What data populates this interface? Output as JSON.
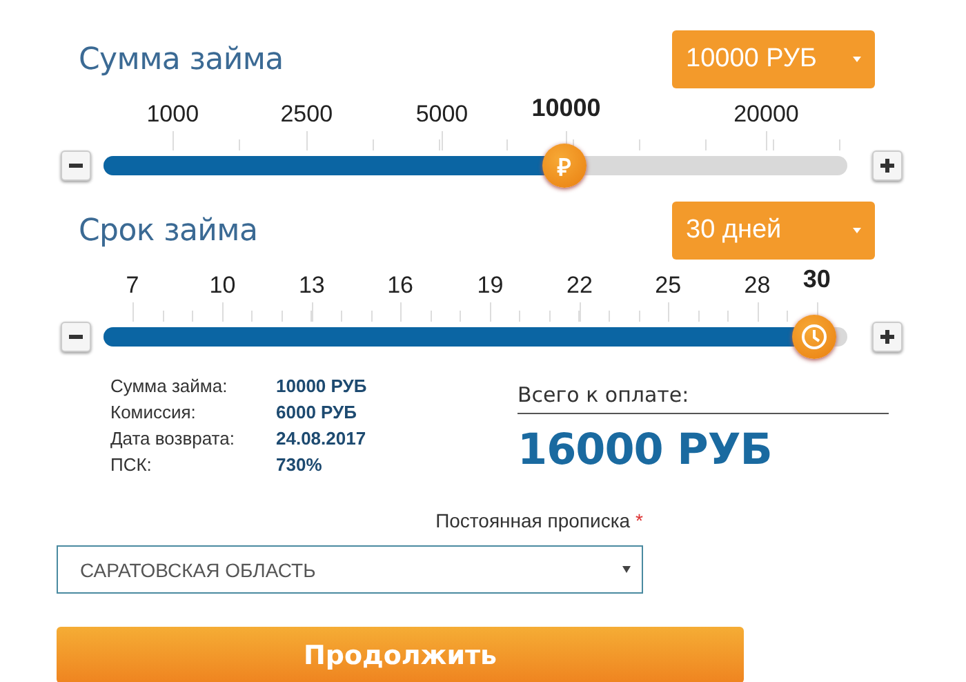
{
  "sliders": [
    {
      "kind": "amount",
      "title": "Сумма займа",
      "dropdown": "10000 РУБ",
      "thumb_text": "₽",
      "level": 0.62,
      "ticks": [
        {
          "label": "1000",
          "selected": false
        },
        {
          "label": "2500",
          "selected": false
        },
        {
          "label": "5000",
          "selected": false
        },
        {
          "label": "10000",
          "selected": true
        },
        {
          "label": "20000",
          "selected": false
        }
      ]
    },
    {
      "kind": "term",
      "title": "Срок займа",
      "dropdown": "30 дней",
      "level": 0.955,
      "ticks": [
        {
          "label": "7",
          "selected": false
        },
        {
          "label": "10",
          "selected": false
        },
        {
          "label": "13",
          "selected": false
        },
        {
          "label": "16",
          "selected": false
        },
        {
          "label": "19",
          "selected": false
        },
        {
          "label": "22",
          "selected": false
        },
        {
          "label": "25",
          "selected": false
        },
        {
          "label": "28",
          "selected": false
        },
        {
          "label": "30",
          "selected": true
        }
      ]
    }
  ],
  "summary": {
    "rows": [
      {
        "label": "Сумма займа:",
        "value": "10000 РУБ"
      },
      {
        "label": "Комиссия:",
        "value": "6000 РУБ"
      },
      {
        "label": "Дата возврата:",
        "value": "24.08.2017"
      },
      {
        "label": "ПСК:",
        "value": "730%"
      }
    ],
    "total_label": "Всего к оплате:",
    "total": "16000 РУБ"
  },
  "form": {
    "field_label": "Постоянная прописка",
    "required_mark": "*",
    "select_value": "САРАТОВСКАЯ ОБЛАСТЬ",
    "submit": "Продолжить"
  }
}
